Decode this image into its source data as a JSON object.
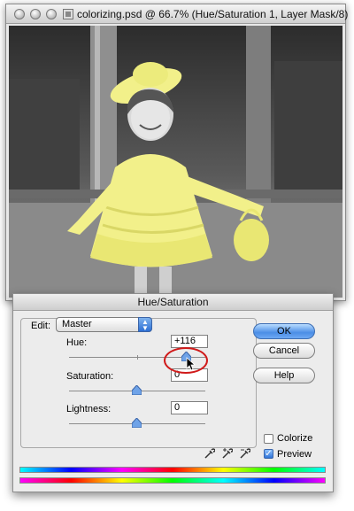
{
  "window": {
    "title": "colorizing.psd @ 66.7% (Hue/Saturation 1, Layer Mask/8)"
  },
  "dialog": {
    "title": "Hue/Saturation",
    "edit_label": "Edit:",
    "edit_value": "Master",
    "hue": {
      "label": "Hue:",
      "value": "+116",
      "slider_level": 0.82
    },
    "saturation": {
      "label": "Saturation:",
      "value": "0",
      "slider_level": 0.5
    },
    "lightness": {
      "label": "Lightness:",
      "value": "0",
      "slider_level": 0.5
    },
    "buttons": {
      "ok": "OK",
      "cancel": "Cancel",
      "help": "Help"
    },
    "colorize": {
      "label": "Colorize",
      "checked": false
    },
    "preview": {
      "label": "Preview",
      "checked": true
    }
  },
  "colors": {
    "dress_highlight": "#f2f08a",
    "annotation_ring": "#d01a1a",
    "button_accent": "#4b8ee6"
  },
  "icons": [
    "close-icon",
    "minimize-icon",
    "zoom-icon",
    "document-proxy-icon",
    "select-arrows-icon",
    "eyedropper-icon",
    "eyedropper-plus-icon",
    "eyedropper-minus-icon",
    "pointer-cursor-icon"
  ]
}
